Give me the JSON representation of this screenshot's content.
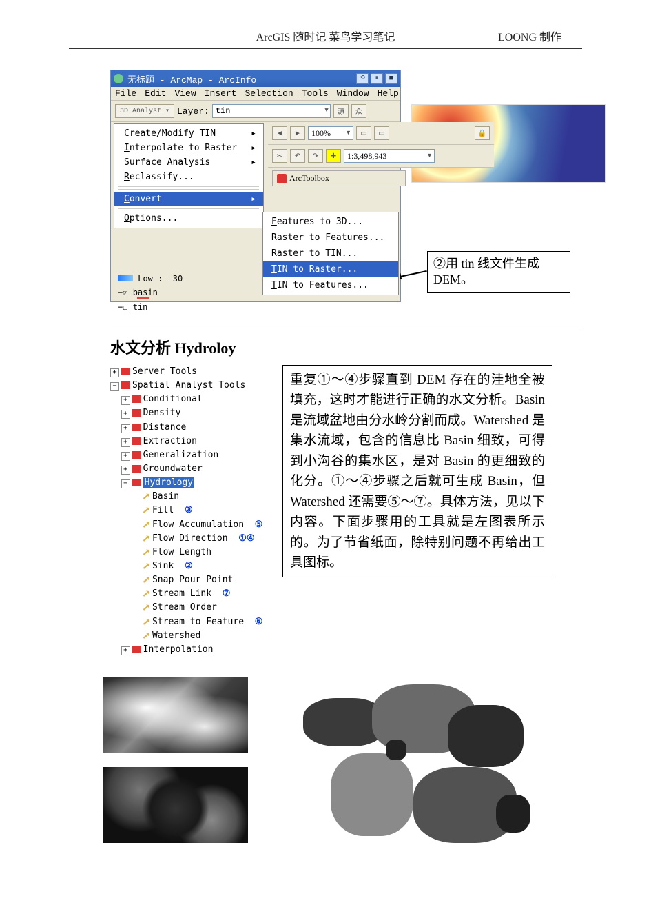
{
  "header": {
    "left": "ArcGIS 随时记  菜鸟学习笔记",
    "right": "LOONG 制作"
  },
  "arcmap": {
    "title": "无标题 - ArcMap - ArcInfo",
    "winbuttons": [
      "⟲",
      "⏸",
      "■"
    ],
    "menubar": [
      {
        "u": "F",
        "rest": "ile"
      },
      {
        "u": "E",
        "rest": "dit"
      },
      {
        "u": "V",
        "rest": "iew"
      },
      {
        "u": "I",
        "rest": "nsert"
      },
      {
        "u": "S",
        "rest": "election"
      },
      {
        "u": "T",
        "rest": "ools"
      },
      {
        "u": "W",
        "rest": "indow"
      },
      {
        "u": "H",
        "rest": "elp"
      }
    ],
    "toolbar3d": "3D Analyst ▾",
    "layerLabel": "Layer:",
    "layerValue": "tin",
    "zoomVal": "100%",
    "scaleVal": "1:3,498,943",
    "arcToolbox": "ArcToolbox",
    "dropmenu": [
      {
        "label": "Create/Modify TIN",
        "arrow": true,
        "u": "M"
      },
      {
        "label": "Interpolate to Raster",
        "arrow": true,
        "u": "I"
      },
      {
        "label": "Surface Analysis",
        "arrow": true,
        "u": "S"
      },
      {
        "label": "Reclassify...",
        "u": "R"
      },
      {
        "label": "Convert",
        "arrow": true,
        "sel": true,
        "u": "C"
      },
      {
        "label": "Options...",
        "u": "O"
      }
    ],
    "submenu": [
      "Features to 3D...",
      "Raster to Features...",
      "Raster to TIN...",
      "TIN to Raster...",
      "TIN to Features..."
    ],
    "submenuSelectedIndex": 3,
    "tocLowLabel": "Low : -30",
    "tocBasin": "basin",
    "tocTin": "tin",
    "callout": "②用 tin 线文件生成 DEM。"
  },
  "section": {
    "title": "水文分析 Hydroloy"
  },
  "tree": {
    "top1": "Server Tools",
    "top2": "Spatial Analyst Tools",
    "subs": [
      "Conditional",
      "Density",
      "Distance",
      "Extraction",
      "Generalization",
      "Groundwater"
    ],
    "hydro": "Hydrology",
    "hydroTools": [
      {
        "name": "Basin",
        "step": ""
      },
      {
        "name": "Fill",
        "step": "③"
      },
      {
        "name": "Flow Accumulation",
        "step": "⑤"
      },
      {
        "name": "Flow Direction",
        "step": "①④"
      },
      {
        "name": "Flow Length",
        "step": ""
      },
      {
        "name": "Sink",
        "step": "②"
      },
      {
        "name": "Snap Pour Point",
        "step": ""
      },
      {
        "name": "Stream Link",
        "step": "⑦"
      },
      {
        "name": "Stream Order",
        "step": ""
      },
      {
        "name": "Stream to Feature",
        "step": "⑥"
      },
      {
        "name": "Watershed",
        "step": ""
      }
    ],
    "interp": "Interpolation"
  },
  "explain": "重复①～④步骤直到 DEM 存在的洼地全被填充，这时才能进行正确的水文分析。Basin 是流域盆地由分水岭分割而成。Watershed 是集水流域，包含的信息比 Basin 细致，可得到小沟谷的集水区，是对 Basin 的更细致的化分。①～④步骤之后就可生成 Basin，但 Watershed 还需要⑤～⑦。具体方法，见以下内容。下面步骤用的工具就是左图表所示的。为了节省纸面，除特别问题不再给出工具图标。"
}
